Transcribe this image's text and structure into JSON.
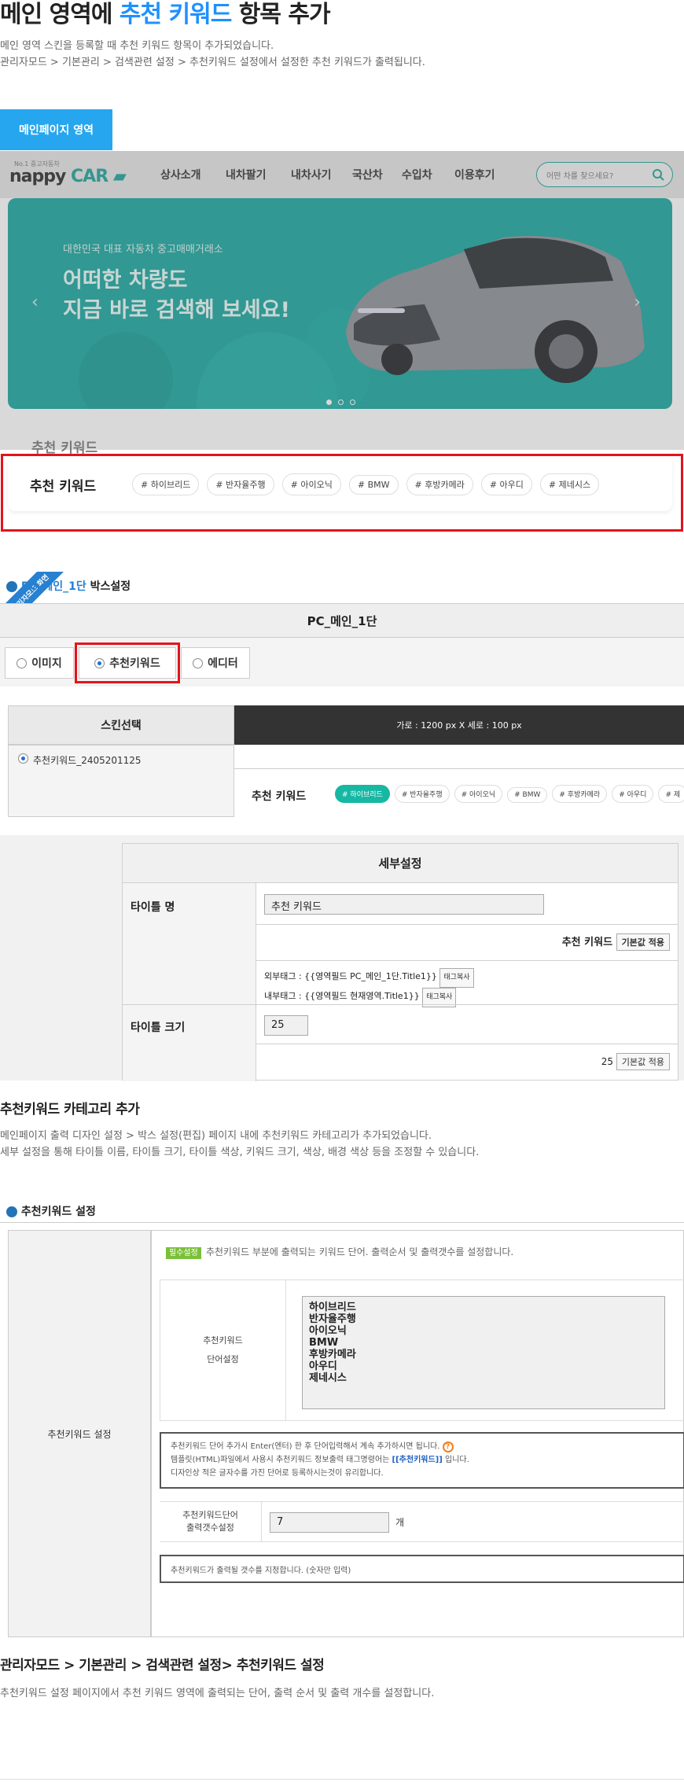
{
  "header": {
    "title_pre": "메인 영역에 ",
    "title_highlight": "추천 키워드",
    "title_post": " 항목 추가",
    "desc_line1": "메인 영역 스킨을 등록할 때 추천 키워드 항목이 추가되었습니다.",
    "desc_line2": "관리자모드 > 기본관리 > 검색관련 설정 > 추천키워드 설정에서 설정한 추천 키워드가 출력됩니다."
  },
  "main_tab": "메인페이지 영역",
  "site": {
    "logo_tagline": "No.1 중고자동차",
    "logo_text": "nappy",
    "logo_car": "CAR",
    "nav": [
      "상사소개",
      "내차팔기",
      "내차사기",
      "국산차",
      "수입차",
      "이용후기"
    ],
    "search_placeholder": "어떤 차를 찾으세요?",
    "banner_sub": "대한민국 대표 자동차 중고매매거래소",
    "banner_line1": "어떠한 차량도",
    "banner_line2": "지금 바로 검색해 보세요!",
    "kw_title": "추천 키워드",
    "keywords": [
      "# 하이브리드",
      "# 반자율주행",
      "# 아이오닉",
      "# BMW",
      "# 후방카메라",
      "# 아우디",
      "# 제네시스"
    ]
  },
  "box_setting": {
    "badge": "관리자모드 화면",
    "title_prefix": "PC_메인_1단",
    "title_suffix": "박스설정",
    "bar_title": "PC_메인_1단",
    "options": [
      "이미지",
      "추천키워드",
      "에디터"
    ],
    "skin_header": "스킨선택",
    "size_label": "가로 : 1200 px X 세로 : 100 px",
    "skin_item": "추천키워드_2405201125",
    "preview_title": "추천 키워드",
    "preview_keywords": [
      "# 하이브리드",
      "# 반자율주행",
      "# 아이오닉",
      "# BMW",
      "# 후방카메라",
      "# 아우디",
      "# 제"
    ]
  },
  "detail": {
    "header": "세부설정",
    "title_label": "타이틀 명",
    "title_value": "추천 키워드",
    "title_preview": "추천 키워드",
    "default_btn": "기본값 적용",
    "outer_tag": "외부태그 : {{영역필드 PC_메인_1단.Title1}}",
    "inner_tag": "내부태그 : {{영역필드 현재영역.Title1}}",
    "tag_copy": "태그복사",
    "size_label": "타이틀 크기",
    "size_value": "25",
    "size_preview": "25"
  },
  "section2": {
    "title": "추천키워드 카테고리 추가",
    "line1": "메인페이지 출력 디자인 설정 > 박스 설정(편집) 페이지 내에 추천키워드 카테고리가 추가되었습니다.",
    "line2": "세부 설정을 통해 타이틀 이름, 타이틀 크기, 타이틀 색상, 키워드 크기, 색상, 배경 색상 등을 조정할 수 있습니다."
  },
  "kw_setting": {
    "title": "추천키워드 설정",
    "left_label": "추천키워드 설정",
    "badge": "필수설정",
    "notice": "추천키워드 부분에 출력되는 키워드 단어. 출력순서 및 출력갯수를 설정합니다.",
    "word_label_1": "추천키워드",
    "word_label_2": "단어설정",
    "words": "하이브리드\n반자율주행\n아이오닉\nBMW\n후방카메라\n아우디\n제네시스",
    "help1": "추천키워드 단어 추가시 Enter(엔터) 한 후 단어입력해서 계속 추가하시면 됩니다.",
    "help2_pre": "템플릿(HTML)파일에서 사용시 추천키워드 정보출력 태그명령어는 ",
    "help2_tag": "[[추천키워드]]",
    "help2_post": " 입니다.",
    "help3": "디자인상 적은 글자수를 가진 단어로 등록하시는것이 유리합니다.",
    "count_label_1": "추천키워드단어",
    "count_label_2": "출력갯수설정",
    "count_value": "7",
    "count_unit": "개",
    "count_help": "추천키워드가 출력될 갯수를 지정합니다. (숫자만 입력)"
  },
  "footer": {
    "path": "관리자모드 > 기본관리 > 검색관련 설정> 추천키워드 설정",
    "desc": "추천키워드 설정 페이지에서 추천 키워드 영역에 출력되는 단어, 출력 순서 및 출력 개수를 설정합니다."
  }
}
